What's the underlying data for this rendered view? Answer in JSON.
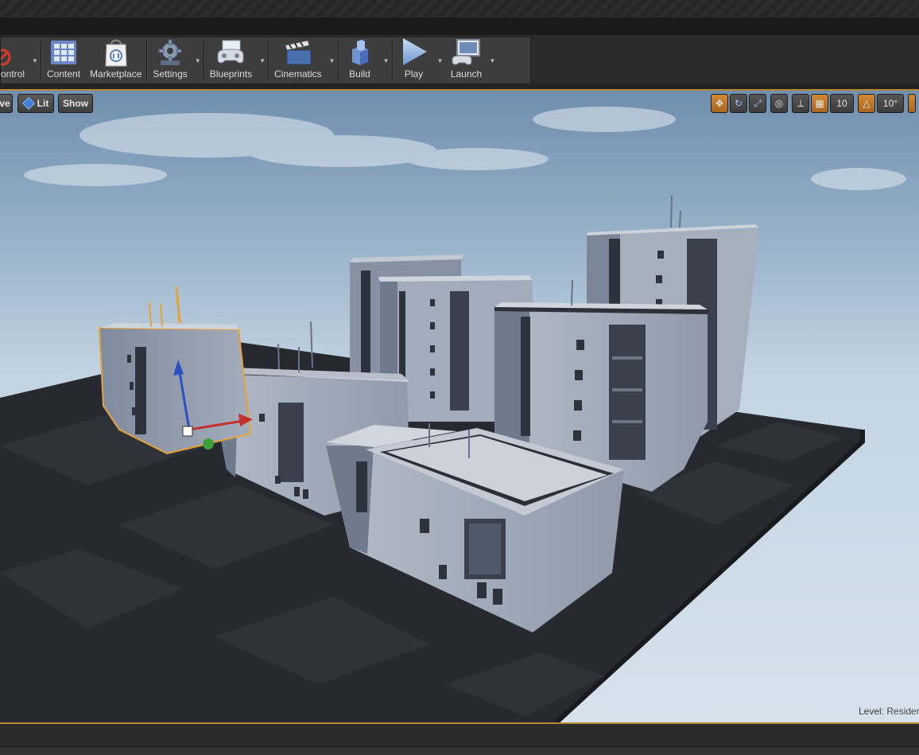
{
  "toolbar": {
    "items": [
      {
        "label": "ontrol",
        "icon": "source-control-icon",
        "dropdown": true
      },
      {
        "label": "Content",
        "icon": "content-browser-icon",
        "dropdown": false
      },
      {
        "label": "Marketplace",
        "icon": "marketplace-icon",
        "dropdown": false
      },
      {
        "label": "Settings",
        "icon": "settings-gear-icon",
        "dropdown": true
      },
      {
        "label": "Blueprints",
        "icon": "blueprints-gamepad-icon",
        "dropdown": true
      },
      {
        "label": "Cinematics",
        "icon": "cinematics-clapper-icon",
        "dropdown": true
      },
      {
        "label": "Build",
        "icon": "build-blocks-icon",
        "dropdown": true
      },
      {
        "label": "Play",
        "icon": "play-icon",
        "dropdown": true
      },
      {
        "label": "Launch",
        "icon": "launch-monitor-icon",
        "dropdown": true
      }
    ]
  },
  "viewport": {
    "perspective_label": "ve",
    "lit_label": "Lit",
    "show_label": "Show",
    "grid_snap_value": "10",
    "rotation_snap_value": "10°",
    "level_label": "Level:",
    "level_name": "Resider",
    "active_color": "#c77f2e",
    "selection_color": "#e8a23a"
  }
}
